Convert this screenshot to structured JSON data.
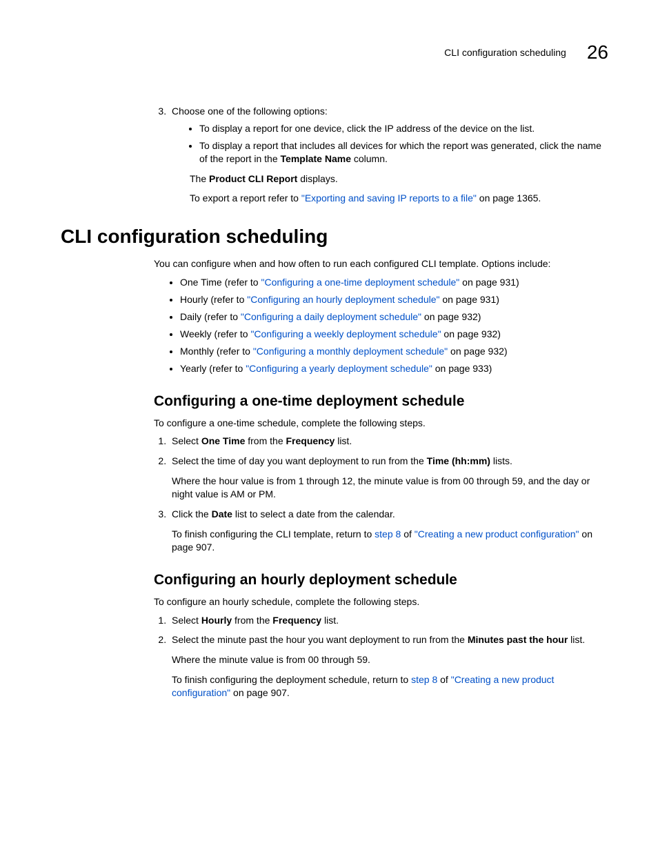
{
  "header": {
    "title": "CLI configuration scheduling",
    "chapter": "26"
  },
  "top": {
    "step3_intro": "Choose one of the following options:",
    "sub_a": "To display a report for one device, click the IP address of the device on the list.",
    "sub_b_pre": "To display a report that includes all devices for which the report was generated, click the name of the report in the ",
    "sub_b_bold": "Template Name",
    "sub_b_post": " column.",
    "the": "The ",
    "pcr": "Product CLI Report",
    "displays": " displays.",
    "export_pre": "To export a report refer to ",
    "export_link": "\"Exporting and saving IP reports to a file\"",
    "export_post": " on page 1365."
  },
  "main": {
    "h1": "CLI configuration scheduling",
    "intro": "You can configure when and how often to run each configured CLI template. Options include:",
    "opts": {
      "one_pre": "One Time (refer to ",
      "one_link": "\"Configuring a one-time deployment schedule\"",
      "one_post": " on page 931)",
      "hour_pre": "Hourly (refer to ",
      "hour_link": "\"Configuring an hourly deployment schedule\"",
      "hour_post": " on page 931)",
      "day_pre": "Daily (refer to ",
      "day_link": "\"Configuring a daily deployment schedule\"",
      "day_post": " on page 932)",
      "week_pre": "Weekly (refer to ",
      "week_link": "\"Configuring a weekly deployment schedule\"",
      "week_post": " on page 932)",
      "month_pre": "Monthly (refer to ",
      "month_link": "\"Configuring a monthly deployment schedule\"",
      "month_post": " on page 932)",
      "year_pre": "Yearly (refer to ",
      "year_link": "\"Configuring a yearly deployment schedule\"",
      "year_post": " on page 933)"
    }
  },
  "onetime": {
    "h2": "Configuring a one-time deployment schedule",
    "intro": "To configure a one-time schedule, complete the following steps.",
    "s1_a": "Select ",
    "s1_b": "One Time",
    "s1_c": " from the ",
    "s1_d": "Frequency",
    "s1_e": " list.",
    "s2_a": "Select the time of day you want deployment to run from the ",
    "s2_b": "Time (hh:mm)",
    "s2_c": " lists.",
    "s2_note": "Where the hour value is from 1 through 12, the minute value is from 00 through 59, and the day or night value is AM or PM.",
    "s3_a": "Click the ",
    "s3_b": "Date",
    "s3_c": " list to select a date from the calendar.",
    "s3_note_a": "To finish configuring the CLI template, return to ",
    "s3_note_b": "step 8",
    "s3_note_c": " of ",
    "s3_note_d": "\"Creating a new product configuration\"",
    "s3_note_e": " on page 907."
  },
  "hourly": {
    "h2": "Configuring an hourly deployment schedule",
    "intro": "To configure an hourly schedule, complete the following steps.",
    "s1_a": "Select ",
    "s1_b": "Hourly",
    "s1_c": " from the ",
    "s1_d": "Frequency",
    "s1_e": " list.",
    "s2_a": "Select the minute past the hour you want deployment to run from the ",
    "s2_b": "Minutes past the hour",
    "s2_c": " list.",
    "s2_note": "Where the minute value is from 00 through 59.",
    "s2_fin_a": "To finish configuring the deployment schedule, return to ",
    "s2_fin_b": "step 8",
    "s2_fin_c": " of ",
    "s2_fin_d": "\"Creating a new product configuration\"",
    "s2_fin_e": " on page 907."
  }
}
